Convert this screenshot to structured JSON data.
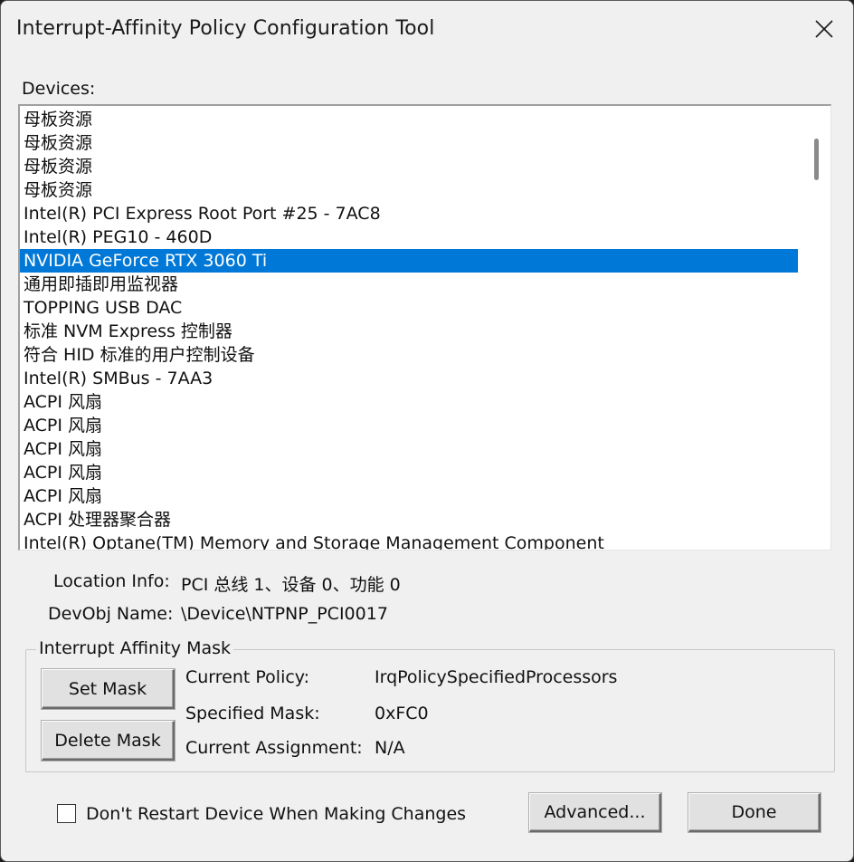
{
  "window": {
    "title": "Interrupt-Affinity Policy Configuration Tool"
  },
  "devices": {
    "label": "Devices:",
    "items": [
      "母板资源",
      "母板资源",
      "母板资源",
      "母板资源",
      "Intel(R) PCI Express Root Port #25 - 7AC8",
      "Intel(R) PEG10 - 460D",
      "NVIDIA GeForce RTX 3060 Ti",
      "通用即插即用监视器",
      "TOPPING USB DAC",
      "标准 NVM Express 控制器",
      "符合 HID 标准的用户控制设备",
      "Intel(R) SMBus - 7AA3",
      "ACPI 风扇",
      "ACPI 风扇",
      "ACPI 风扇",
      "ACPI 风扇",
      "ACPI 风扇",
      "ACPI 处理器聚合器",
      "Intel(R) Optane(TM) Memory and Storage Management Component"
    ],
    "selected_index": 6
  },
  "info": {
    "location_label": "Location Info:",
    "location_value": "PCI 总线 1、设备 0、功能 0",
    "devobj_label": "DevObj Name:",
    "devobj_value": "\\Device\\NTPNP_PCI0017"
  },
  "mask_group": {
    "title": "Interrupt Affinity Mask",
    "set_mask_label": "Set Mask",
    "delete_mask_label": "Delete Mask",
    "current_policy_label": "Current Policy:",
    "current_policy_value": "IrqPolicySpecifiedProcessors",
    "specified_mask_label": "Specified Mask:",
    "specified_mask_value": "0xFC0",
    "current_assignment_label": "Current Assignment:",
    "current_assignment_value": "N/A"
  },
  "footer": {
    "dont_restart_label": "Don't Restart Device When Making Changes",
    "dont_restart_checked": false,
    "advanced_label": "Advanced...",
    "done_label": "Done"
  },
  "colors": {
    "selection": "#0078d7",
    "window_bg": "#f0f0f0"
  }
}
